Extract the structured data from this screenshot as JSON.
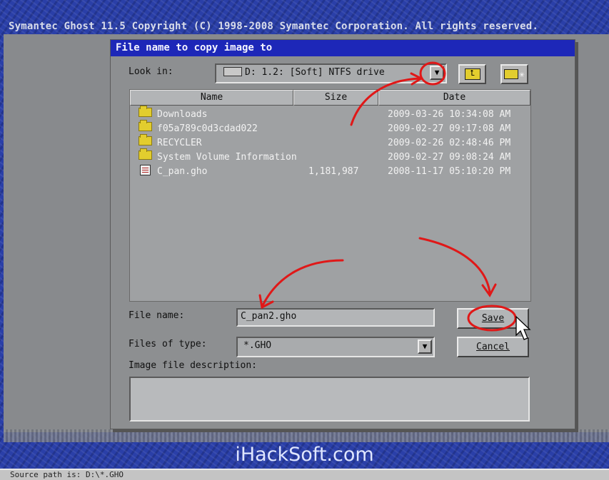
{
  "app": {
    "title": "Symantec Ghost 11.5   Copyright (C) 1998-2008 Symantec Corporation. All rights reserved."
  },
  "dialog": {
    "title": "File name to copy image to",
    "look_in_label": "Look in:",
    "look_in_value": "D: 1.2: [Soft] NTFS drive",
    "columns": {
      "name": "Name",
      "size": "Size",
      "date": "Date"
    },
    "files": [
      {
        "name": "Downloads",
        "size": "",
        "date": "2009-03-26 10:34:08 AM",
        "icon": "folder-icon"
      },
      {
        "name": "f05a789c0d3cdad022",
        "size": "",
        "date": "2009-02-27 09:17:08 AM",
        "icon": "folder-icon"
      },
      {
        "name": "RECYCLER",
        "size": "",
        "date": "2009-02-26 02:48:46 PM",
        "icon": "folder-icon"
      },
      {
        "name": "System Volume Information",
        "size": "",
        "date": "2009-02-27 09:08:24 AM",
        "icon": "folder-icon"
      },
      {
        "name": "C_pan.gho",
        "size": "1,181,987",
        "date": "2008-11-17 05:10:20 PM",
        "icon": "file-icon"
      }
    ],
    "file_name_label": "File name:",
    "file_name_value": "C_pan2.gho",
    "files_of_type_label": "Files of type:",
    "files_of_type_value": "*.GHO",
    "description_label": "Image file description:",
    "description_value": "",
    "save_label": "Save",
    "cancel_label": "Cancel"
  },
  "watermark": "iHackSoft.com",
  "status": {
    "text": "Source path is: D:\\*.GHO"
  },
  "colors": {
    "title_bar": "#1d27b8",
    "annotation": "#e01818",
    "folder": "#e2cd2e"
  }
}
